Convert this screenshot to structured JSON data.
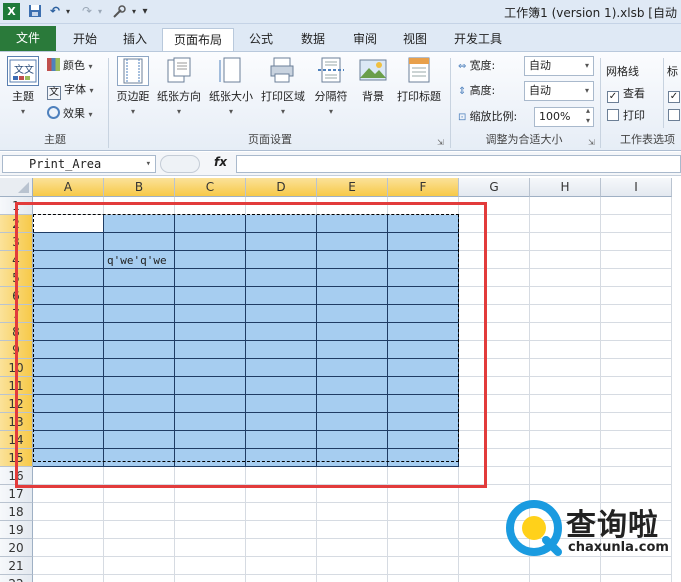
{
  "window": {
    "title": "工作簿1 (version 1).xlsb [自动"
  },
  "quick_access": {
    "excel_icon": "X",
    "undo_symbol": "↶",
    "redo_symbol": "↷",
    "customize_symbol": "▾"
  },
  "tabs": {
    "file": "文件",
    "items": [
      "开始",
      "插入",
      "页面布局",
      "公式",
      "数据",
      "审阅",
      "视图",
      "开发工具"
    ],
    "active": "页面布局"
  },
  "ribbon": {
    "themes": {
      "theme": "主题",
      "colors": "颜色",
      "fonts": "字体",
      "effects": "效果",
      "group": "主题"
    },
    "page_setup": {
      "margins": "页边距",
      "orientation": "纸张方向",
      "size": "纸张大小",
      "print_area": "打印区域",
      "breaks": "分隔符",
      "background": "背景",
      "print_titles": "打印标题",
      "group": "页面设置"
    },
    "scale_to_fit": {
      "width_label": "宽度:",
      "width_value": "自动",
      "height_label": "高度:",
      "height_value": "自动",
      "scale_label": "缩放比例:",
      "scale_value": "100%",
      "group": "调整为合适大小"
    },
    "sheet_options": {
      "gridlines": "网格线",
      "view": "查看",
      "print": "打印",
      "headings_partial": "标",
      "group": "工作表选项"
    }
  },
  "formula_bar": {
    "name_box": "Print_Area",
    "fx": "fx",
    "value": ""
  },
  "sheet": {
    "columns": [
      "A",
      "B",
      "C",
      "D",
      "E",
      "F",
      "G",
      "H",
      "I"
    ],
    "rows": [
      "1",
      "2",
      "3",
      "4",
      "5",
      "6",
      "7",
      "8",
      "9",
      "10",
      "11",
      "12",
      "13",
      "14",
      "15",
      "16",
      "17",
      "18",
      "19",
      "20",
      "21",
      "22"
    ],
    "cell_text": "q'we'q'we",
    "print_area_range": "A2:F15"
  },
  "watermark": {
    "brand": "查询啦",
    "domain": "chaxunla.com"
  },
  "colors": {
    "print_area_fill": "#a6cdf0",
    "highlight_box": "#e23b3b",
    "header_selected": "#f7c948",
    "file_tab": "#2a7a3a"
  }
}
